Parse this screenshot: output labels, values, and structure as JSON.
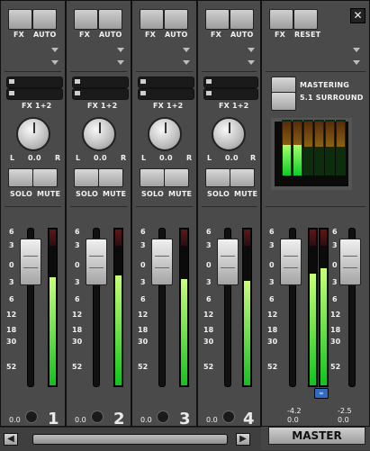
{
  "channels": [
    {
      "number": "1",
      "fx_label": "FX",
      "auto_label": "AUTO",
      "fx12_label": "FX 1+2",
      "pan_l": "L",
      "pan_value": "0.0",
      "pan_r": "R",
      "solo_label": "SOLO",
      "mute_label": "MUTE",
      "gain_value": "0.0"
    },
    {
      "number": "2",
      "fx_label": "FX",
      "auto_label": "AUTO",
      "fx12_label": "FX 1+2",
      "pan_l": "L",
      "pan_value": "0.0",
      "pan_r": "R",
      "solo_label": "SOLO",
      "mute_label": "MUTE",
      "gain_value": "0.0"
    },
    {
      "number": "3",
      "fx_label": "FX",
      "auto_label": "AUTO",
      "fx12_label": "FX 1+2",
      "pan_l": "L",
      "pan_value": "0.0",
      "pan_r": "R",
      "solo_label": "SOLO",
      "mute_label": "MUTE",
      "gain_value": "0.0"
    },
    {
      "number": "4",
      "fx_label": "FX",
      "auto_label": "AUTO",
      "fx12_label": "FX 1+2",
      "pan_l": "L",
      "pan_value": "0.0",
      "pan_r": "R",
      "solo_label": "SOLO",
      "mute_label": "MUTE",
      "gain_value": "0.0"
    }
  ],
  "fader_scale": [
    "6",
    "3",
    "0",
    "3",
    "6",
    "12",
    "18",
    "30",
    "52"
  ],
  "master": {
    "fx_label": "FX",
    "reset_label": "RESET",
    "mastering_label": "MASTERING",
    "surround_label": "5.1 SURROUND",
    "left_peak": "-4.2",
    "left_gain": "0.0",
    "right_peak": "-2.5",
    "right_gain": "0.0",
    "label": "MASTER",
    "close_glyph": "✕",
    "link_glyph": "∞"
  },
  "scroll": {
    "left_glyph": "◀",
    "right_glyph": "▶"
  }
}
